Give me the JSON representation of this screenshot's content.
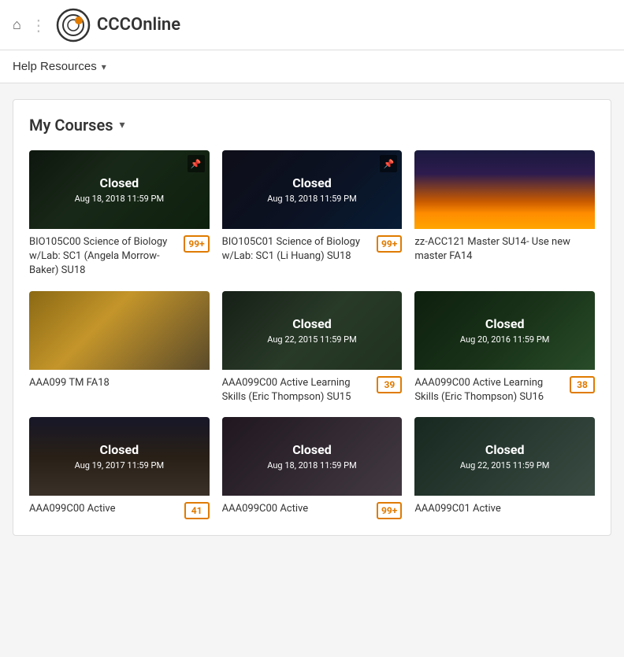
{
  "header": {
    "home_icon": "⌂",
    "dots_icon": "⋮",
    "logo_text": "CCCOnline"
  },
  "help_bar": {
    "label": "Help Resources",
    "chevron": "▾"
  },
  "courses_section": {
    "title": "My Courses",
    "chevron": "▾",
    "courses": [
      {
        "id": "bio105c00",
        "name": "BIO105C00 Science of Biology w/Lab: SC1 (Angela Morrow-Baker) SU18",
        "badge": "99+",
        "closed": true,
        "closed_date": "Aug 18, 2018 11:59 PM",
        "bg_class": "bg-bio1",
        "pinned": true
      },
      {
        "id": "bio105c01",
        "name": "BIO105C01 Science of Biology w/Lab: SC1 (Li Huang) SU18",
        "badge": "99+",
        "closed": true,
        "closed_date": "Aug 18, 2018 11:59 PM",
        "bg_class": "bg-bio2",
        "pinned": true
      },
      {
        "id": "zz-acc121",
        "name": "zz-ACC121 Master SU14- Use new master FA14",
        "badge": null,
        "closed": false,
        "closed_date": null,
        "bg_class": "bg-mountain",
        "pinned": false
      },
      {
        "id": "aaa099-tm",
        "name": "AAA099 TM FA18",
        "badge": null,
        "closed": false,
        "closed_date": null,
        "bg_class": "bg-bridge",
        "pinned": false
      },
      {
        "id": "aaa099c00-su15",
        "name": "AAA099C00 Active Learning Skills (Eric Thompson) SU15",
        "badge": "39",
        "closed": true,
        "closed_date": "Aug 22, 2015 11:59 PM",
        "bg_class": "bg-desert",
        "pinned": false
      },
      {
        "id": "aaa099c00-su16",
        "name": "AAA099C00 Active Learning Skills (Eric Thompson) SU16",
        "badge": "38",
        "closed": true,
        "closed_date": "Aug 20, 2016 11:59 PM",
        "bg_class": "bg-tree",
        "pinned": false
      },
      {
        "id": "aaa099c00-fa17",
        "name": "AAA099C00 Active",
        "badge": "41",
        "closed": true,
        "closed_date": "Aug 19, 2017 11:59 PM",
        "bg_class": "bg-mountain2",
        "pinned": false
      },
      {
        "id": "aaa099c00-su18",
        "name": "AAA099C00 Active",
        "badge": "99+",
        "closed": true,
        "closed_date": "Aug 18, 2018 11:59 PM",
        "bg_class": "bg-students",
        "pinned": false
      },
      {
        "id": "aaa099c01-su15",
        "name": "AAA099C01 Active",
        "badge": null,
        "closed": true,
        "closed_date": "Aug 22, 2015 11:59 PM",
        "bg_class": "bg-outdoor",
        "pinned": false
      }
    ]
  }
}
